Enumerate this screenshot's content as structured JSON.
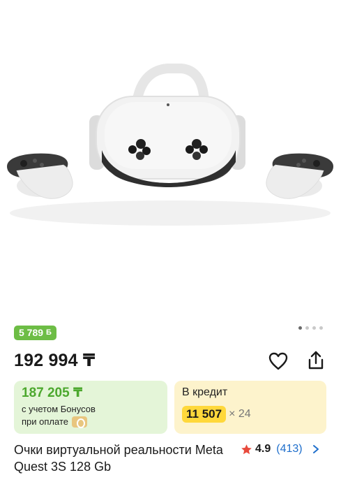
{
  "gallery": {
    "image_description_icon": "vr-headset-with-controllers-image",
    "dots_total": 4,
    "dots_active_index": 0
  },
  "bonus_badge": {
    "amount": "5 789",
    "icon": "Б"
  },
  "price": {
    "value": "192 994 ₸"
  },
  "bonus_card": {
    "amount": "187 205 ₸",
    "note_line1": "с учетом Бонусов",
    "note_line2": "при оплате"
  },
  "credit_card": {
    "label": "В кредит",
    "monthly": "11 507",
    "multiplier": "× 24"
  },
  "product": {
    "title": "Очки виртуальной реальности Meta Quest 3S 128 Gb"
  },
  "rating": {
    "value": "4.9",
    "count": "(413)"
  },
  "colors": {
    "green": "#6dbd45",
    "green_text": "#4ca82e",
    "green_bg": "#e4f5d8",
    "yellow_bg": "#fdf3cc",
    "yellow_highlight": "#ffd83b",
    "link_blue": "#1f6fcc",
    "star_red": "#e84a3c"
  }
}
